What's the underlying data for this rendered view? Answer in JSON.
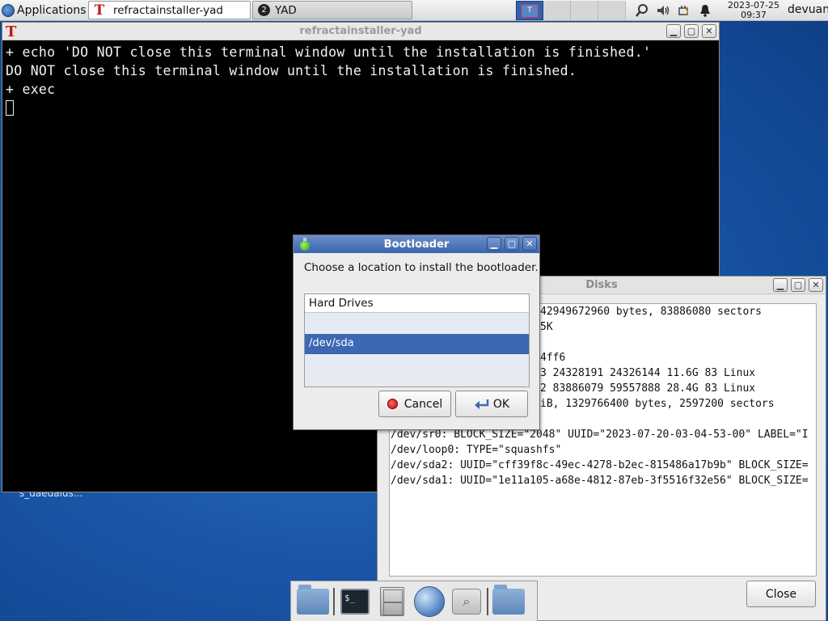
{
  "panel": {
    "applications_label": "Applications",
    "tasks": [
      {
        "label": "refractainstaller-yad",
        "active": true
      },
      {
        "label": "YAD",
        "group_count": "2",
        "active": false
      }
    ],
    "clock": {
      "date": "2023-07-25",
      "time": "09:37"
    },
    "user": "devuan"
  },
  "desktop": {
    "icon_label": "s_daedalus..."
  },
  "terminal": {
    "title": "refractainstaller-yad",
    "lines": [
      "+ echo 'DO NOT close this terminal window until the installation is finished.'",
      "DO NOT close this terminal window until the installation is finished.",
      "+ exec"
    ]
  },
  "disks": {
    "title": "Disks",
    "lines": [
      "42949672960 bytes, 83886080 sectors",
      "5K",
      "",
      "4ff6",
      "3 24328191 24326144 11.6G 83 Linux",
      "2 83886079 59557888 28.4G 83 Linux",
      "iB, 1329766400 bytes, 2597200 sectors",
      "",
      "/dev/sr0: BLOCK_SIZE=\"2048\" UUID=\"2023-07-20-03-04-53-00\" LABEL=\"I",
      "/dev/loop0: TYPE=\"squashfs\"",
      "/dev/sda2: UUID=\"cff39f8c-49ec-4278-b2ec-815486a17b9b\" BLOCK_SIZE=",
      "/dev/sda1: UUID=\"1e11a105-a68e-4812-87eb-3f5516f32e56\" BLOCK_SIZE="
    ],
    "close_label": "Close"
  },
  "bootloader": {
    "title": "Bootloader",
    "prompt": "Choose a location to install the bootloader.",
    "column_header": "Hard Drives",
    "items": [
      "/dev/sda"
    ],
    "cancel_label": "Cancel",
    "ok_label": "OK"
  },
  "colors": {
    "dialog_title_bg": "#3a65ad",
    "selection_bg": "#3b67b3",
    "desktop_bg": "#1a56a8"
  },
  "dock": {
    "items": [
      "file-manager-icon",
      "terminal-icon",
      "file-cabinet-icon",
      "web-browser-icon",
      "search-icon",
      "folder-icon"
    ]
  }
}
